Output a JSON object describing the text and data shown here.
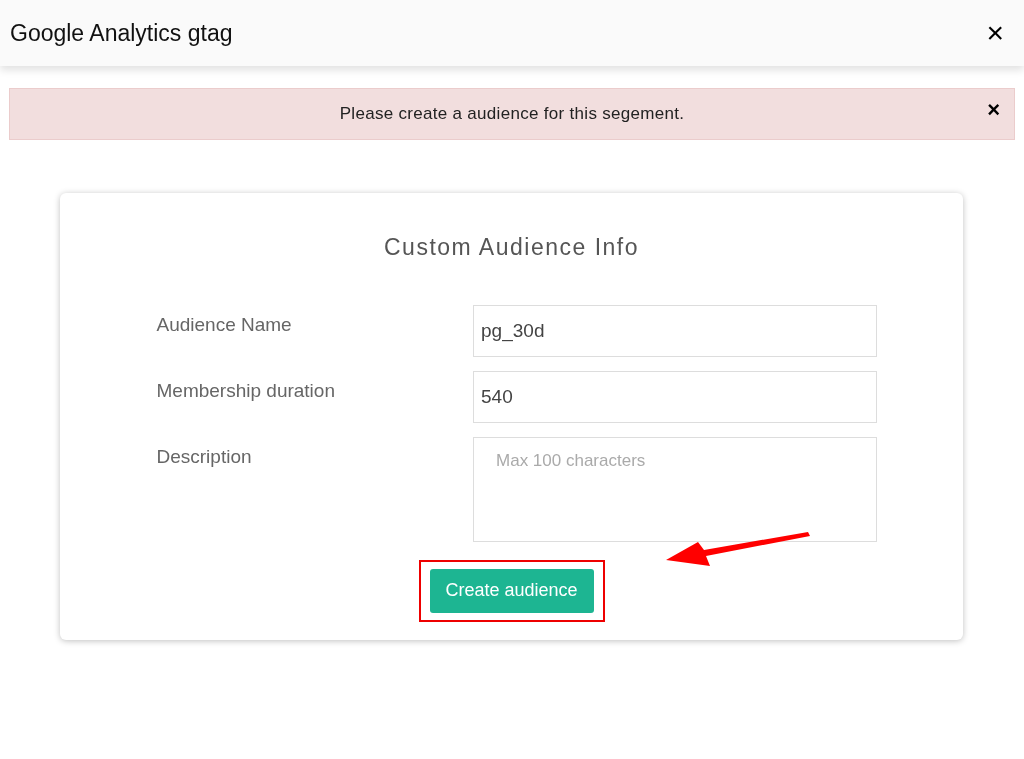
{
  "window": {
    "title": "Google Analytics gtag",
    "close": "×"
  },
  "alert": {
    "message": "Please create a audience for this segement.",
    "close": "×"
  },
  "card": {
    "title": "Custom Audience Info",
    "fields": [
      {
        "label": "Audience Name",
        "kind": "input",
        "value": "pg_30d"
      },
      {
        "label": "Membership duration",
        "kind": "input",
        "value": "540"
      },
      {
        "label": "Description",
        "kind": "textarea",
        "placeholder": "Max 100 characters"
      }
    ],
    "button": "Create audience"
  }
}
